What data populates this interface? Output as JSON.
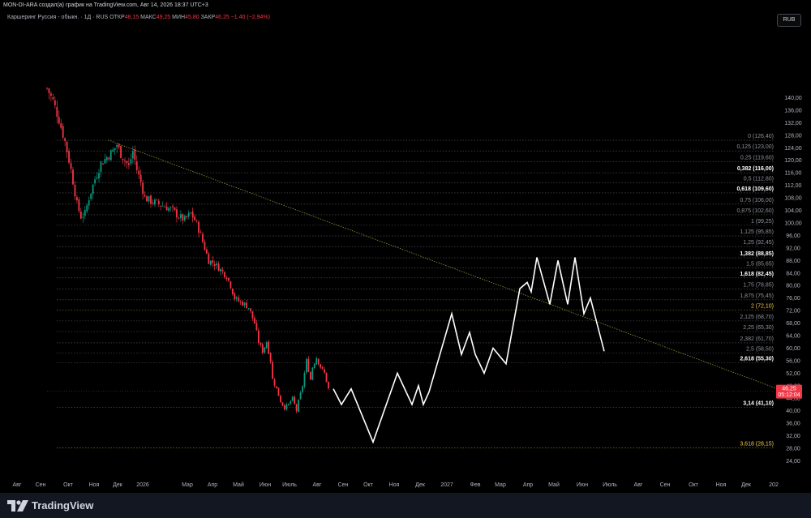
{
  "header": {
    "attribution": "MON-DI-ARA создал(а) график на TradingView.com, Авг 14, 2026 18:37 UTC+3"
  },
  "symbol": {
    "name": "Каршеринг Руссия - обыкн. · 1Д · RUS",
    "open_label": "ОТКР",
    "open": "48,15",
    "high_label": "МАКС",
    "high": "49,25",
    "low_label": "МИН",
    "low": "45,80",
    "close_label": "ЗАКР",
    "close": "46,25",
    "change": "−1,40 (−2,94%)"
  },
  "currency_button": "RUB",
  "price_tag": {
    "price": "46,25",
    "countdown": "05:12:04"
  },
  "footer": {
    "logo_text": "TradingView"
  },
  "colors": {
    "background": "#000000",
    "up": "#089981",
    "down": "#f23645",
    "fib_highlight": "#f7c948",
    "projection": "#ffffff",
    "trendline": "#c9c94a"
  },
  "chart_data": {
    "type": "candlestick",
    "y_axis": {
      "range": [
        22,
        144
      ],
      "ticks": [
        "24,00",
        "28,00",
        "32,00",
        "36,00",
        "40,00",
        "44,00",
        "48,00",
        "52,00",
        "56,00",
        "60,00",
        "64,00",
        "68,00",
        "72,00",
        "76,00",
        "80,00",
        "84,00",
        "88,00",
        "92,00",
        "96,00",
        "100,00",
        "104,00",
        "108,00",
        "112,00",
        "116,00",
        "120,00",
        "124,00",
        "128,00",
        "132,00",
        "136,00",
        "140,00"
      ]
    },
    "x_axis": {
      "labels": [
        "Авг",
        "Сен",
        "Окт",
        "Ноя",
        "Дек",
        "2026",
        "Мар",
        "Апр",
        "Май",
        "Июн",
        "Июль",
        "Авг",
        "Сен",
        "Окт",
        "Ноя",
        "Дек",
        "2027",
        "Фев",
        "Мар",
        "Апр",
        "Май",
        "Июн",
        "Июль",
        "Авг",
        "Сен",
        "Окт",
        "Ноя",
        "Дек",
        "202"
      ]
    },
    "fib_levels": [
      {
        "label": "0 (126,40)",
        "value": 126.4,
        "style": "normal"
      },
      {
        "label": "0,125 (123,00)",
        "value": 123.0,
        "style": "normal"
      },
      {
        "label": "0,25 (119,60)",
        "value": 119.6,
        "style": "normal"
      },
      {
        "label": "0,382 (116,00)",
        "value": 116.0,
        "style": "bold"
      },
      {
        "label": "0,5 (112,80)",
        "value": 112.8,
        "style": "normal"
      },
      {
        "label": "0,618 (109,60)",
        "value": 109.6,
        "style": "bold"
      },
      {
        "label": "0,75 (106,00)",
        "value": 106.0,
        "style": "normal"
      },
      {
        "label": "0,875 (102,60)",
        "value": 102.6,
        "style": "normal"
      },
      {
        "label": "1 (99,25)",
        "value": 99.25,
        "style": "normal"
      },
      {
        "label": "1,125 (95,85)",
        "value": 95.85,
        "style": "normal"
      },
      {
        "label": "1,25 (92,45)",
        "value": 92.45,
        "style": "normal"
      },
      {
        "label": "1,382 (88,85)",
        "value": 88.85,
        "style": "bold"
      },
      {
        "label": "1,5 (85,65)",
        "value": 85.65,
        "style": "normal"
      },
      {
        "label": "1,618 (82,45)",
        "value": 82.45,
        "style": "bold"
      },
      {
        "label": "1,75 (78,85)",
        "value": 78.85,
        "style": "normal"
      },
      {
        "label": "1,875 (75,45)",
        "value": 75.45,
        "style": "normal"
      },
      {
        "label": "2 (72,10)",
        "value": 72.1,
        "style": "highlight"
      },
      {
        "label": "2,125 (68,70)",
        "value": 68.7,
        "style": "normal"
      },
      {
        "label": "2,25 (65,30)",
        "value": 65.3,
        "style": "normal"
      },
      {
        "label": "2,382 (61,70)",
        "value": 61.7,
        "style": "normal"
      },
      {
        "label": "2,5 (58,50)",
        "value": 58.5,
        "style": "normal"
      },
      {
        "label": "2,618 (55,30)",
        "value": 55.3,
        "style": "bold"
      },
      {
        "label": "3,14 (41,10)",
        "value": 41.1,
        "style": "bold"
      },
      {
        "label": "3,618 (28,15)",
        "value": 28.15,
        "style": "highlight"
      }
    ],
    "price_path": [
      [
        0,
        143
      ],
      [
        3,
        139
      ],
      [
        6,
        133
      ],
      [
        9,
        126
      ],
      [
        12,
        117
      ],
      [
        15,
        106
      ],
      [
        17,
        102
      ],
      [
        19,
        103
      ],
      [
        21,
        108
      ],
      [
        24,
        114
      ],
      [
        27,
        119
      ],
      [
        30,
        121
      ],
      [
        33,
        123
      ],
      [
        35,
        125
      ],
      [
        37,
        122
      ],
      [
        39,
        120
      ],
      [
        41,
        118
      ],
      [
        43,
        123
      ],
      [
        45,
        117
      ],
      [
        47,
        113
      ],
      [
        49,
        108
      ],
      [
        52,
        107
      ],
      [
        56,
        106
      ],
      [
        60,
        105
      ],
      [
        63,
        104
      ],
      [
        66,
        102
      ],
      [
        69,
        101
      ],
      [
        72,
        103
      ],
      [
        74,
        101
      ],
      [
        76,
        98
      ],
      [
        79,
        92
      ],
      [
        81,
        88
      ],
      [
        84,
        87
      ],
      [
        87,
        85
      ],
      [
        90,
        83
      ],
      [
        92,
        80
      ],
      [
        94,
        76
      ],
      [
        96,
        75
      ],
      [
        99,
        74
      ],
      [
        101,
        73
      ],
      [
        104,
        68
      ],
      [
        106,
        62
      ],
      [
        108,
        59
      ],
      [
        110,
        62
      ],
      [
        112,
        56
      ],
      [
        113,
        50
      ],
      [
        115,
        47
      ],
      [
        117,
        43
      ],
      [
        119,
        41
      ],
      [
        121,
        42
      ],
      [
        123,
        44
      ],
      [
        125,
        40
      ],
      [
        126,
        43
      ],
      [
        128,
        48
      ],
      [
        130,
        56
      ],
      [
        132,
        50
      ],
      [
        133,
        54
      ],
      [
        135,
        57
      ],
      [
        137,
        54
      ],
      [
        139,
        52
      ],
      [
        141,
        47
      ]
    ],
    "projection": [
      [
        411,
        47
      ],
      [
        421,
        42
      ],
      [
        433,
        47
      ],
      [
        460,
        30
      ],
      [
        490,
        52
      ],
      [
        508,
        42
      ],
      [
        516,
        48
      ],
      [
        522,
        42
      ],
      [
        529,
        46
      ],
      [
        557,
        71
      ],
      [
        569,
        58
      ],
      [
        579,
        65
      ],
      [
        586,
        58
      ],
      [
        597,
        52
      ],
      [
        608,
        60
      ],
      [
        624,
        55
      ],
      [
        641,
        79
      ],
      [
        650,
        81
      ],
      [
        655,
        78
      ],
      [
        662,
        89
      ],
      [
        678,
        74
      ],
      [
        688,
        88
      ],
      [
        700,
        74
      ],
      [
        709,
        89
      ],
      [
        720,
        71
      ],
      [
        728,
        76
      ],
      [
        745,
        59
      ]
    ],
    "trendline": [
      [
        133,
        126.5
      ],
      [
        990,
        44
      ]
    ]
  }
}
